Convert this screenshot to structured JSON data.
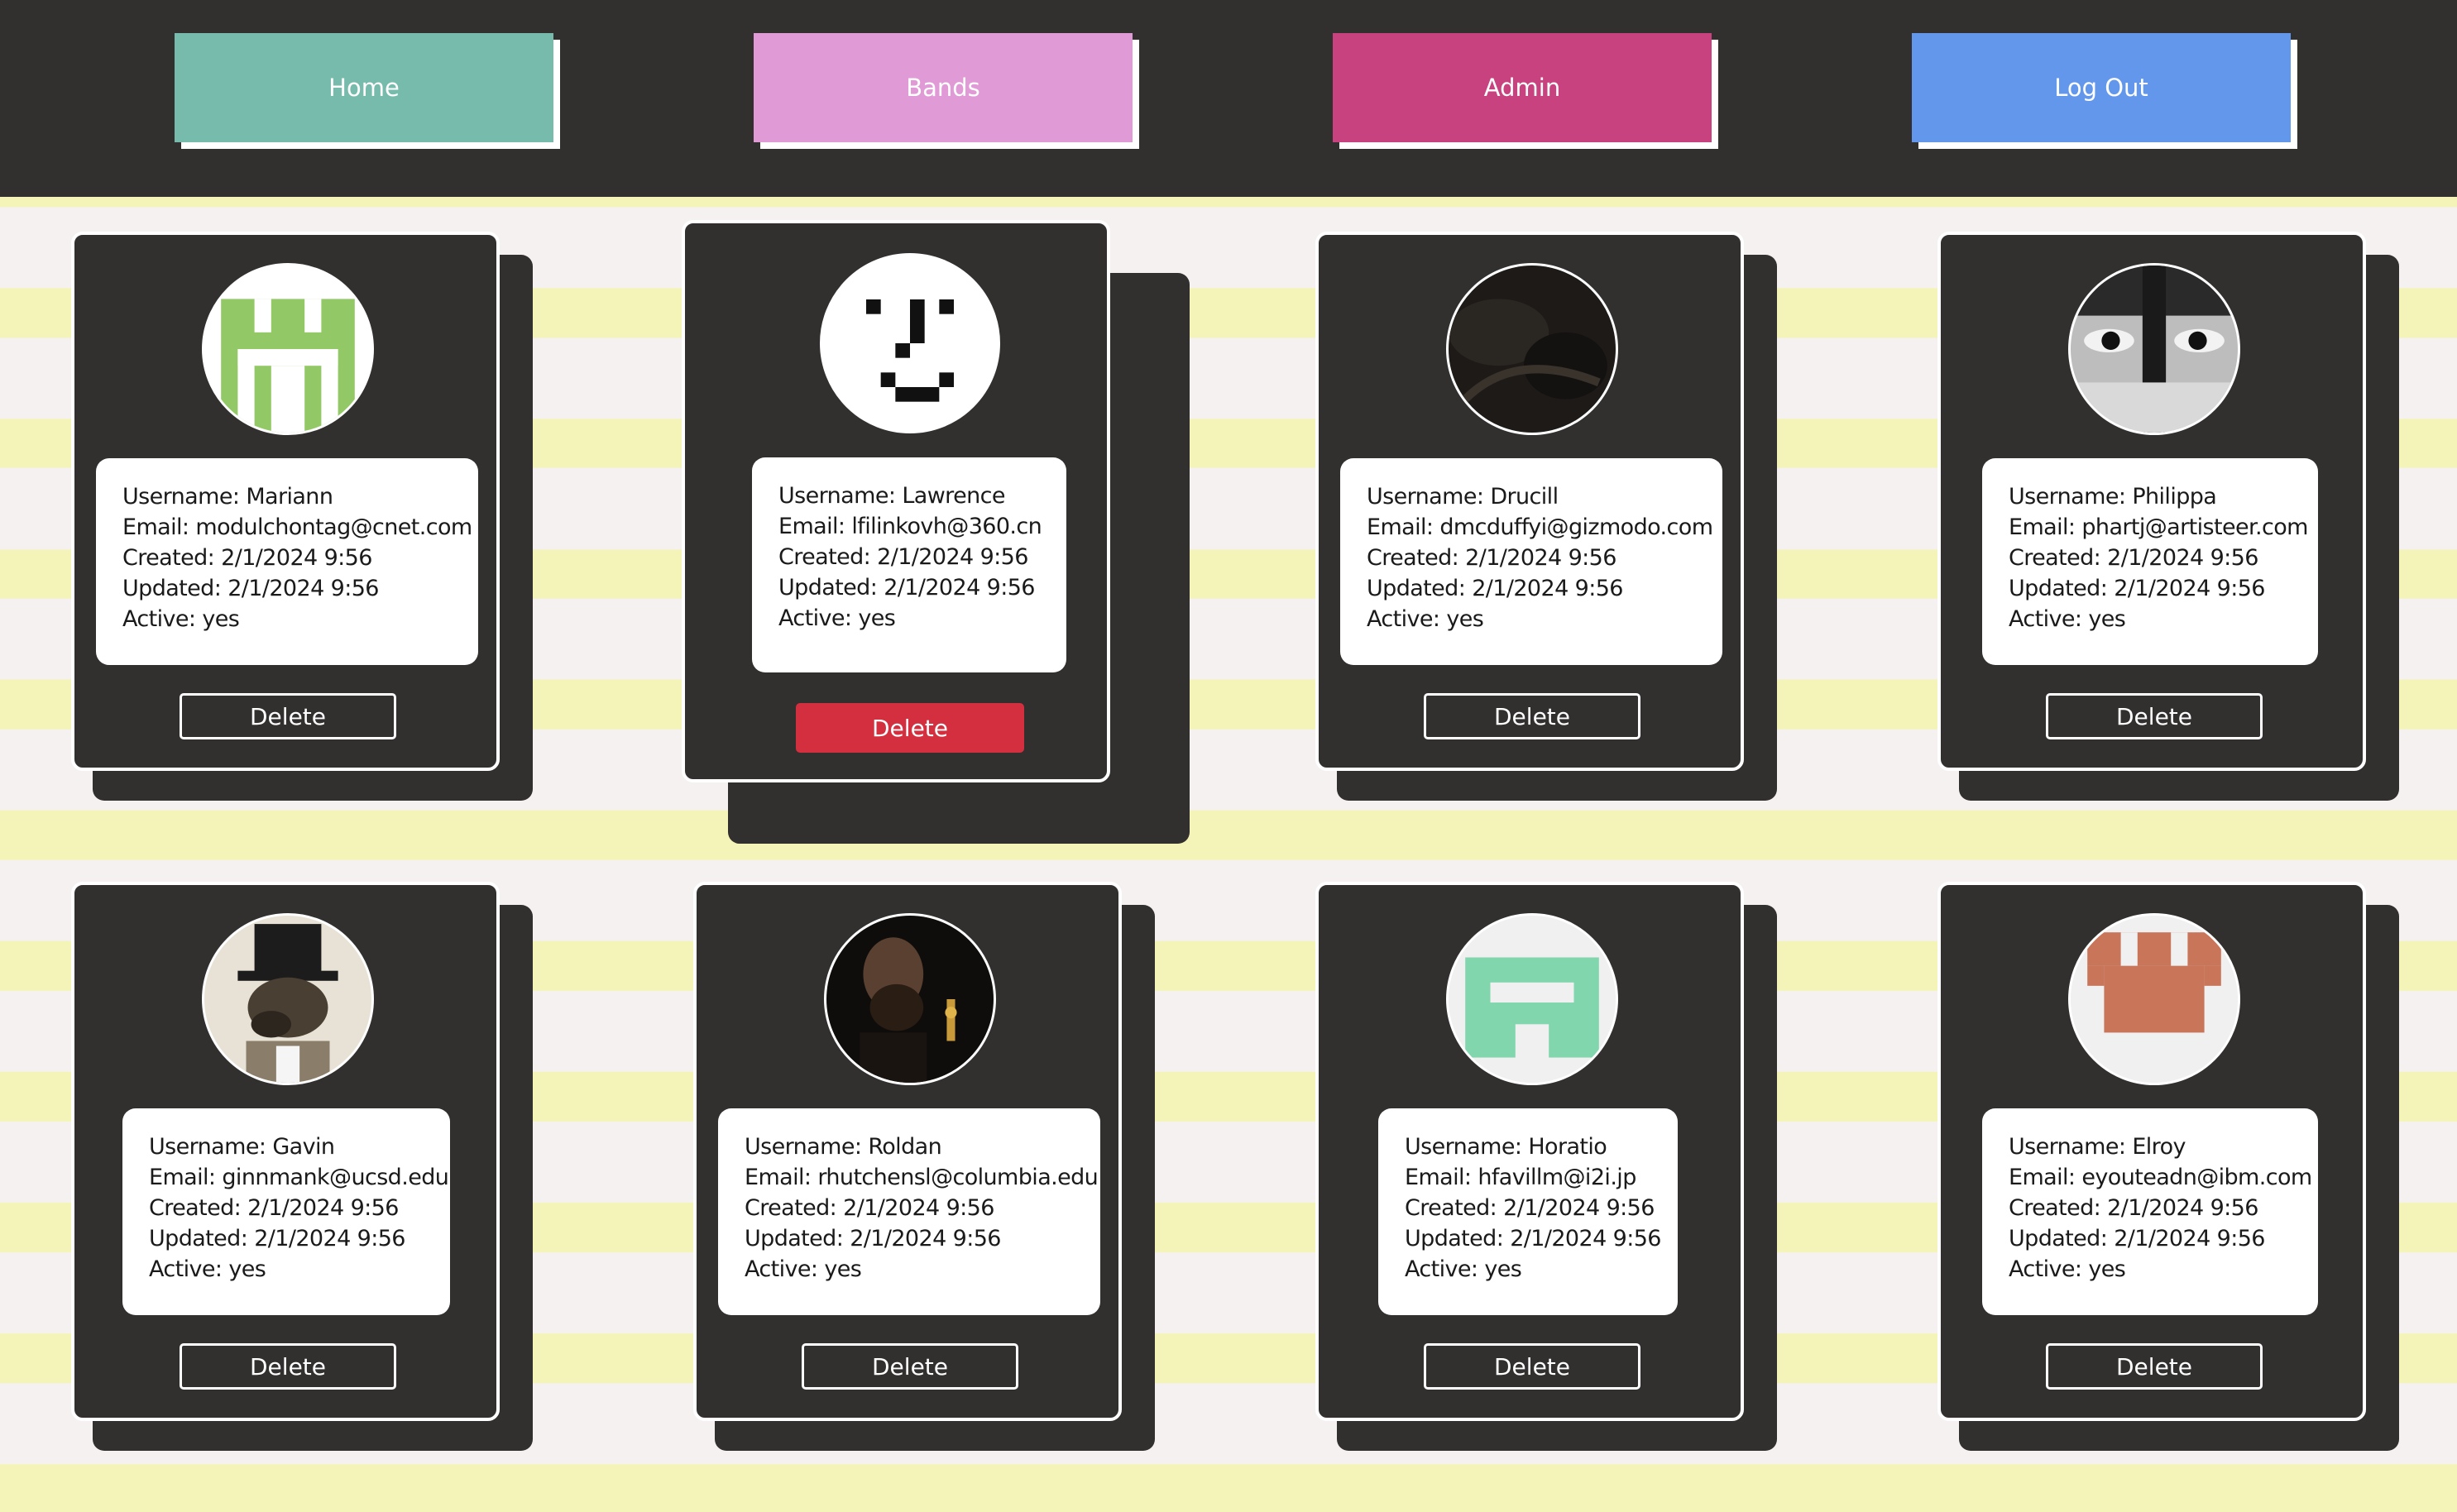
{
  "nav": {
    "items": [
      {
        "label": "Home",
        "color": "#76bbac"
      },
      {
        "label": "Bands",
        "color": "#e09ad5"
      },
      {
        "label": "Admin",
        "color": "#c84280"
      },
      {
        "label": "Log Out",
        "color": "#6397ec"
      }
    ]
  },
  "colors": {
    "page_background": "#f5f1f1",
    "stripe": "#f4f4b8",
    "card": "#322f2f",
    "delete_hover": "#d32f3f"
  },
  "users": [
    {
      "username": "Username: Mariann",
      "email": "Email: modulchontag@cnet.com",
      "created": "Created: 2/1/2024 9:56",
      "updated": "Updated: 2/1/2024 9:56",
      "active": "Active: yes",
      "avatar": "green-pixel-identicon",
      "delete_label": "Delete"
    },
    {
      "username": "Username: Lawrence",
      "email": "Email: lfilinkovh@360.cn",
      "created": "Created: 2/1/2024 9:56",
      "updated": "Updated: 2/1/2024 9:56",
      "active": "Active: yes",
      "avatar": "pixel-face",
      "delete_label": "Delete"
    },
    {
      "username": "Username: Drucill",
      "email": "Email: dmcduffyi@gizmodo.com",
      "created": "Created: 2/1/2024 9:56",
      "updated": "Updated: 2/1/2024 9:56",
      "active": "Active: yes",
      "avatar": "dark-photo",
      "delete_label": "Delete"
    },
    {
      "username": "Username: Philippa",
      "email": "Email: phartj@artisteer.com",
      "created": "Created: 2/1/2024 9:56",
      "updated": "Updated: 2/1/2024 9:56",
      "active": "Active: yes",
      "avatar": "eyes-photo",
      "delete_label": "Delete"
    },
    {
      "username": "Username: Gavin",
      "email": "Email: ginnmank@ucsd.edu",
      "created": "Created: 2/1/2024 9:56",
      "updated": "Updated: 2/1/2024 9:56",
      "active": "Active: yes",
      "avatar": "top-hat-dog",
      "delete_label": "Delete"
    },
    {
      "username": "Username: Roldan",
      "email": "Email: rhutchensl@columbia.edu",
      "created": "Created: 2/1/2024 9:56",
      "updated": "Updated: 2/1/2024 9:56",
      "active": "Active: yes",
      "avatar": "musician-photo",
      "delete_label": "Delete"
    },
    {
      "username": "Username: Horatio",
      "email": "Email: hfavillm@i2i.jp",
      "created": "Created: 2/1/2024 9:56",
      "updated": "Updated: 2/1/2024 9:56",
      "active": "Active: yes",
      "avatar": "mint-pixel-identicon",
      "delete_label": "Delete"
    },
    {
      "username": "Username: Elroy",
      "email": "Email: eyouteadn@ibm.com",
      "created": "Created: 2/1/2024 9:56",
      "updated": "Updated: 2/1/2024 9:56",
      "active": "Active: yes",
      "avatar": "orange-pixel-identicon",
      "delete_label": "Delete"
    }
  ]
}
